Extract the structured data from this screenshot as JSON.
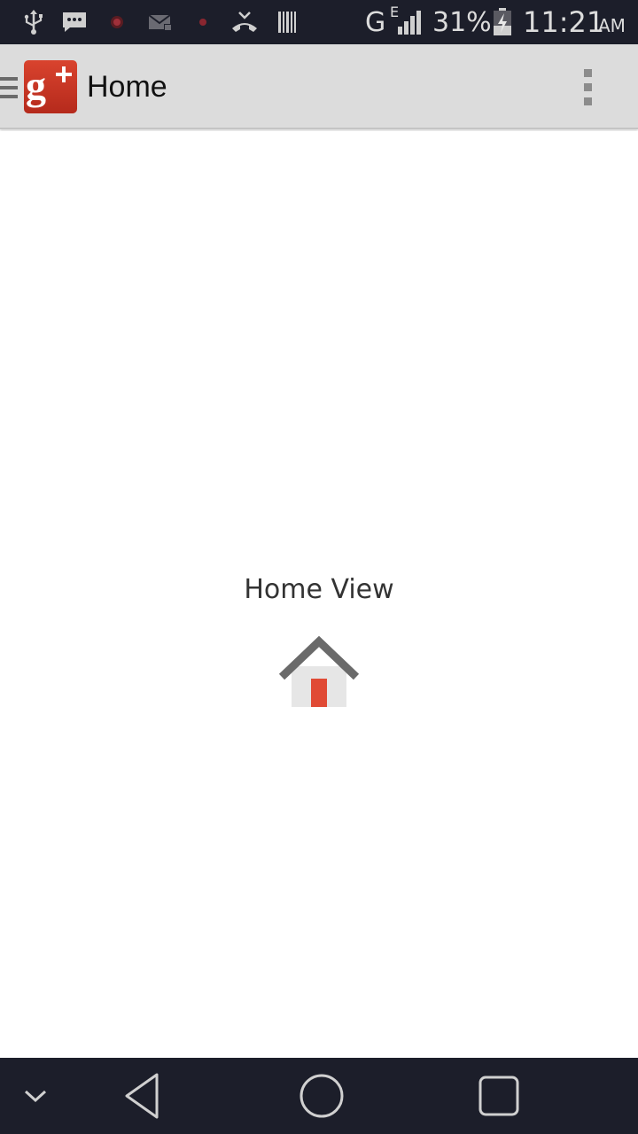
{
  "status_bar": {
    "network_type": "G",
    "network_sub": "E",
    "battery_percent": "31%",
    "time": "11:21",
    "ampm": "AM"
  },
  "action_bar": {
    "title": "Home"
  },
  "content": {
    "label": "Home View"
  },
  "colors": {
    "status_bg": "#1c1e2a",
    "action_bar_bg": "#dcdcdc",
    "gplus_red": "#d9432e",
    "home_door": "#e04a35"
  },
  "icons": [
    "usb-icon",
    "message-icon",
    "record-icon",
    "mail-icon",
    "dot-icon",
    "missed-call-icon",
    "barcode-icon",
    "signal-icon",
    "battery-icon",
    "drawer-icon",
    "google-plus-logo",
    "overflow-menu-icon",
    "home-icon",
    "chevron-down-icon",
    "back-icon",
    "home-nav-icon",
    "recents-icon"
  ]
}
